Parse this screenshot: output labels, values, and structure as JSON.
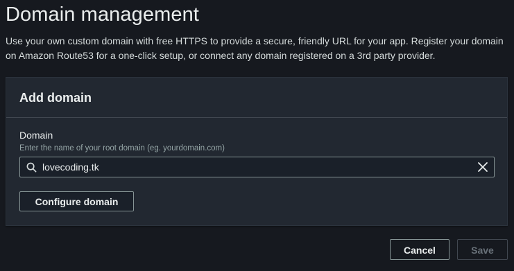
{
  "page": {
    "title": "Domain management",
    "description": "Use your own custom domain with free HTTPS to provide a secure, friendly URL for your app. Register your domain on Amazon Route53 for a one-click setup, or connect any domain registered on a 3rd party provider."
  },
  "panel": {
    "title": "Add domain",
    "domain_field": {
      "label": "Domain",
      "hint": "Enter the name of your root domain (eg. yourdomain.com)",
      "value": "lovecoding.tk",
      "search_icon": "search-icon",
      "clear_icon": "close-icon"
    },
    "configure_label": "Configure domain"
  },
  "footer": {
    "cancel_label": "Cancel",
    "save_label": "Save"
  },
  "colors": {
    "background": "#16191f",
    "panel": "#222831",
    "text_primary": "#eaeded",
    "text_secondary": "#95a5a6",
    "disabled": "#687078"
  }
}
